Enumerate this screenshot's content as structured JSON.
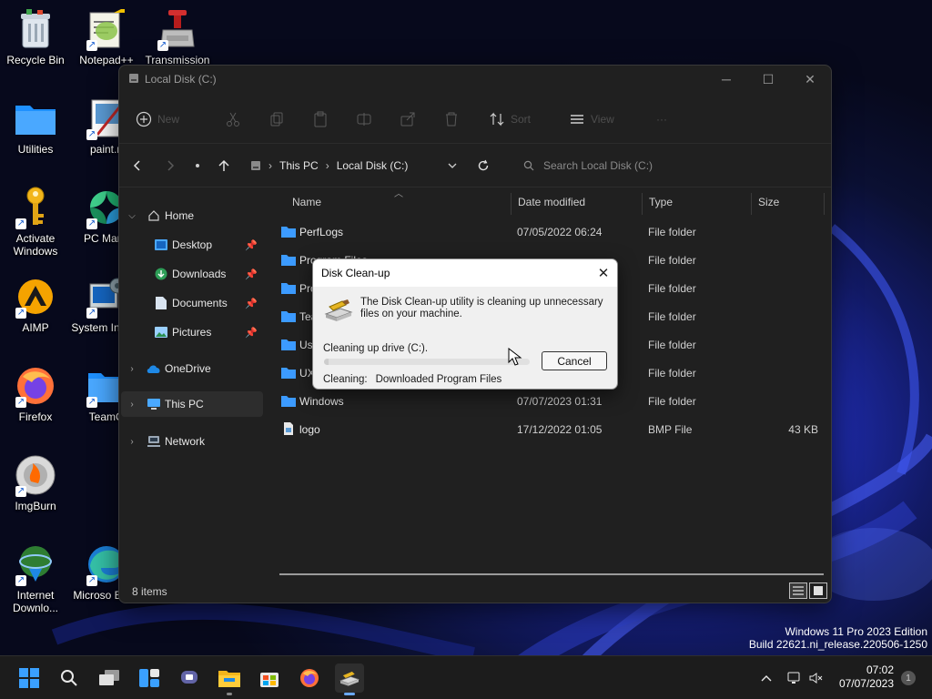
{
  "desktop": {
    "icons": [
      {
        "label": "Recycle Bin"
      },
      {
        "label": "Notepad++"
      },
      {
        "label": "Transmission"
      },
      {
        "label": "Utilities"
      },
      {
        "label": "paint.n"
      },
      {
        "label": "Activate Windows"
      },
      {
        "label": "PC Mana"
      },
      {
        "label": "AIMP"
      },
      {
        "label": "System Inform"
      },
      {
        "label": "Firefox"
      },
      {
        "label": "TeamO"
      },
      {
        "label": "ImgBurn"
      },
      {
        "label": "Internet Downlo..."
      },
      {
        "label": "Microso Edge"
      }
    ],
    "watermark_line1": "Windows 11 Pro 2023 Edition",
    "watermark_line2": "Build 22621.ni_release.220506-1250"
  },
  "explorer": {
    "title": "Local Disk (C:)",
    "toolbar": {
      "new_label": "New",
      "sort_label": "Sort",
      "view_label": "View",
      "more_label": "···"
    },
    "breadcrumb": [
      "This PC",
      "Local Disk (C:)"
    ],
    "search_placeholder": "Search Local Disk (C:)",
    "nav": {
      "home": "Home",
      "desktop": "Desktop",
      "downloads": "Downloads",
      "documents": "Documents",
      "pictures": "Pictures",
      "onedrive": "OneDrive",
      "thispc": "This PC",
      "network": "Network"
    },
    "columns": {
      "name": "Name",
      "date": "Date modified",
      "type": "Type",
      "size": "Size"
    },
    "files": [
      {
        "name": "PerfLogs",
        "date": "07/05/2022 06:24",
        "type": "File folder",
        "size": ""
      },
      {
        "name": "Program Files",
        "date": "",
        "type": "File folder",
        "size": ""
      },
      {
        "name": "Pro",
        "date": "",
        "type": "File folder",
        "size": ""
      },
      {
        "name": "Tea",
        "date": "",
        "type": "File folder",
        "size": ""
      },
      {
        "name": "Use",
        "date": "",
        "type": "File folder",
        "size": ""
      },
      {
        "name": "UX",
        "date": "",
        "type": "File folder",
        "size": ""
      },
      {
        "name": "Windows",
        "date": "07/07/2023 01:31",
        "type": "File folder",
        "size": ""
      },
      {
        "name": "logo",
        "date": "17/12/2022 01:05",
        "type": "BMP File",
        "size": "43 KB"
      }
    ],
    "status": "8 items"
  },
  "dialog": {
    "title": "Disk Clean-up",
    "message": "The Disk Clean-up utility is cleaning up unnecessary files on your machine.",
    "drive_label": "Cleaning up drive  (C:).",
    "progress": 0.02,
    "cancel_label": "Cancel",
    "cleaning_label": "Cleaning:",
    "cleaning_value": "Downloaded Program Files"
  },
  "taskbar": {
    "time": "07:02",
    "date": "07/07/2023",
    "notification_count": "1"
  }
}
